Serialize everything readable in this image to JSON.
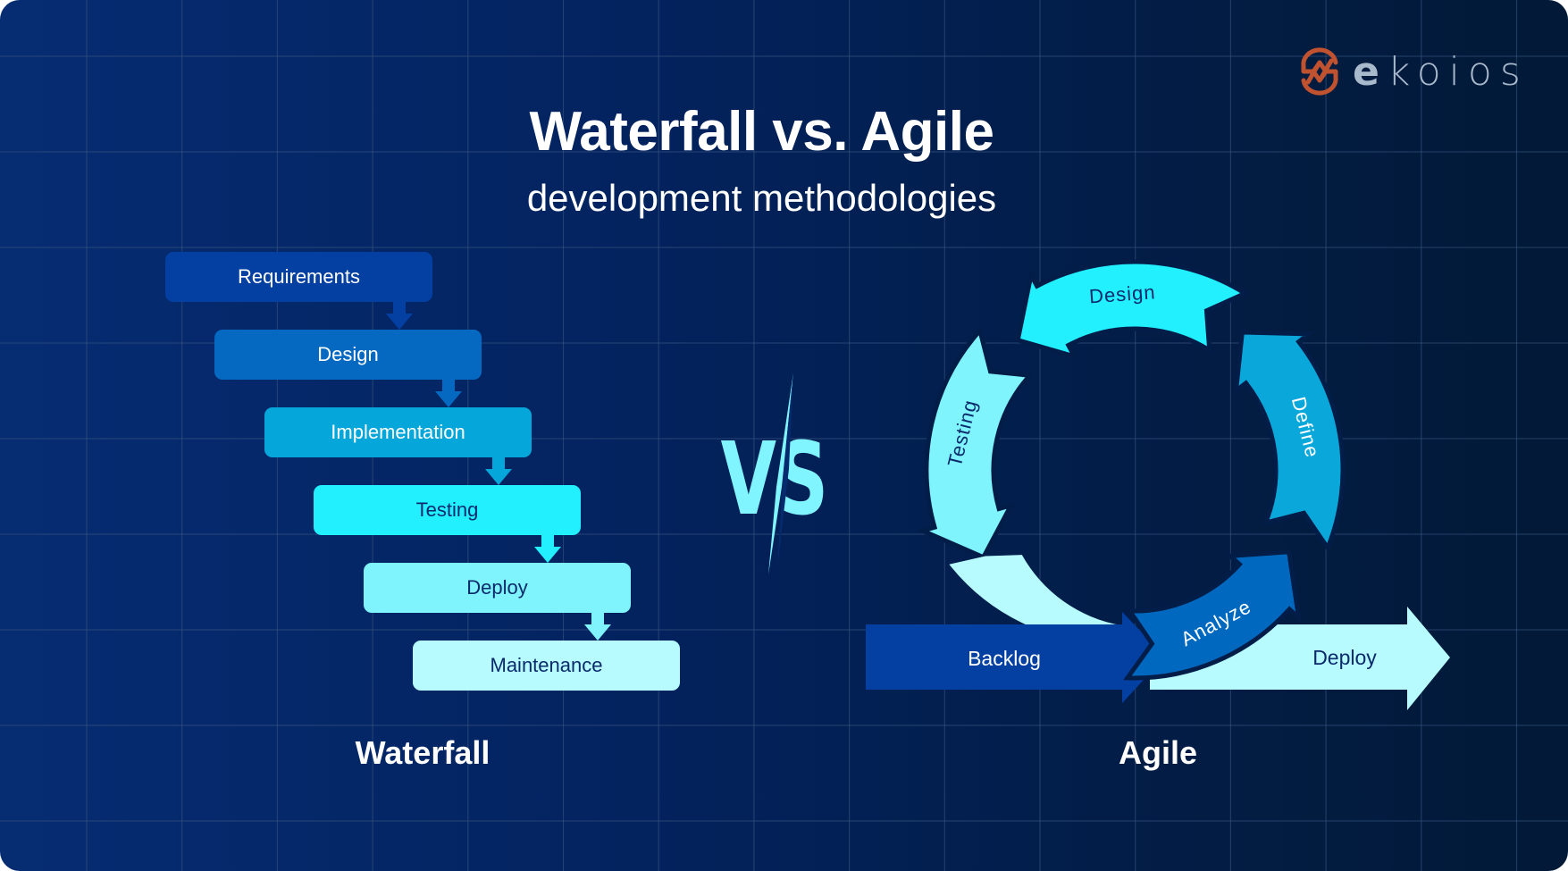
{
  "brand": {
    "name": "ekoios",
    "name_bold_part": "e",
    "name_rest": "koios",
    "icon": "ekoios-logo-icon",
    "color": "#c0522f"
  },
  "header": {
    "title": "Waterfall vs. Agile",
    "subtitle": "development methodologies"
  },
  "waterfall": {
    "label": "Waterfall",
    "steps": [
      {
        "label": "Requirements",
        "color": "#0340a2",
        "text_color": "#ffffff"
      },
      {
        "label": "Design",
        "color": "#0569c1",
        "text_color": "#ffffff"
      },
      {
        "label": "Implementation",
        "color": "#05a6da",
        "text_color": "#ffffff"
      },
      {
        "label": "Testing",
        "color": "#22f0ff",
        "text_color": "#0a2a6b"
      },
      {
        "label": "Deploy",
        "color": "#7ff4fd",
        "text_color": "#0a2a6b"
      },
      {
        "label": "Maintenance",
        "color": "#b8fbff",
        "text_color": "#0a2a6b"
      }
    ],
    "connector_icon": "arrow-down-icon"
  },
  "versus": {
    "text": "VS",
    "color": "#80f4ff"
  },
  "agile": {
    "label": "Agile",
    "cycle": [
      {
        "label": "Analyze",
        "color": "#0069bf",
        "text_color": "#ffffff"
      },
      {
        "label": "Define",
        "color": "#0aa8da",
        "text_color": "#ffffff"
      },
      {
        "label": "Design",
        "color": "#22f0ff",
        "text_color": "#0a2a6b"
      },
      {
        "label": "Testing",
        "color": "#7ff4fd",
        "text_color": "#0a2a6b"
      }
    ],
    "return_arc_color": "#b8fbff",
    "backlog": {
      "label": "Backlog",
      "color": "#0340a2",
      "text_color": "#ffffff"
    },
    "deploy": {
      "label": "Deploy",
      "color": "#b8fbff",
      "text_color": "#0a2a6b"
    }
  },
  "colors": {
    "background_left": "#062c72",
    "background_right": "#021a37",
    "grid_line": "#3a5680",
    "text_light": "#ffffff",
    "text_dark": "#0a2a6b"
  }
}
